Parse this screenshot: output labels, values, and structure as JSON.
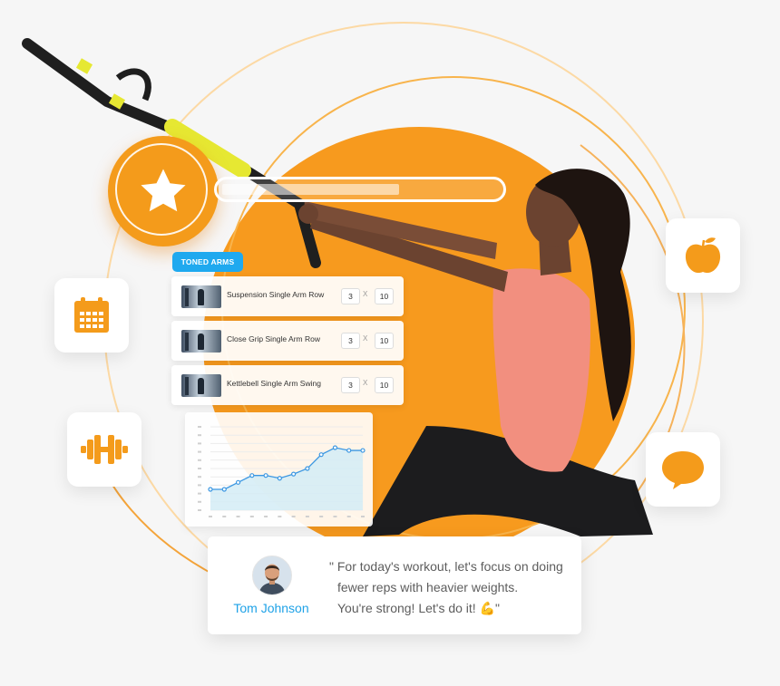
{
  "program": {
    "tag": "TONED ARMS",
    "progress_fraction": 0.64
  },
  "exercises": [
    {
      "name": "Suspension Single Arm Row",
      "sets": "3",
      "times": "X",
      "reps": "10"
    },
    {
      "name": "Close Grip Single Arm Row",
      "sets": "3",
      "times": "X",
      "reps": "10"
    },
    {
      "name": "Kettlebell Single Arm Swing",
      "sets": "3",
      "times": "X",
      "reps": "10"
    }
  ],
  "tiles": {
    "calendar": "calendar-icon",
    "dumbbell": "dumbbell-icon",
    "apple": "apple-icon",
    "chat": "chat-bubble-icon",
    "achievement": "star-icon"
  },
  "chart_data": {
    "type": "area",
    "x": [
      1,
      2,
      3,
      4,
      5,
      6,
      7,
      8,
      9,
      10,
      11,
      12
    ],
    "series": [
      {
        "values": [
          3,
          3,
          4,
          5,
          5,
          4.6,
          5.2,
          6,
          8,
          9,
          8.6,
          8.6
        ]
      }
    ],
    "ylim": [
      0,
      12
    ],
    "grid": true
  },
  "quote": {
    "coach_name": "Tom Johnson",
    "lines": [
      "\" For today's workout, let's focus on doing",
      "fewer reps with heavier weights.",
      "You're strong! Let's do it! 💪\""
    ]
  },
  "colors": {
    "orange": "#f49b1b",
    "tag_blue": "#1fa9ef",
    "coach_blue": "#1fa2e7",
    "chart_line": "#3b97e2"
  }
}
